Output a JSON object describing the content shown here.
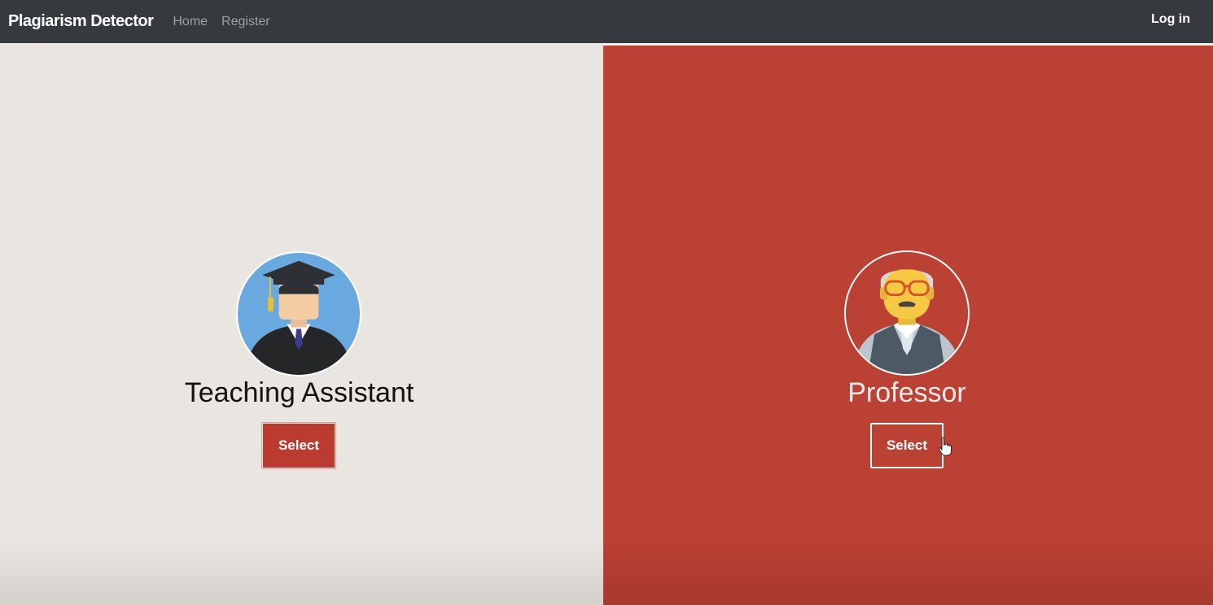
{
  "navbar": {
    "brand": "Plagiarism Detector",
    "links": [
      "Home",
      "Register"
    ],
    "login": "Log in"
  },
  "roles": [
    {
      "title": "Teaching Assistant",
      "button": "Select",
      "avatar_icon": "graduate-avatar-icon"
    },
    {
      "title": "Professor",
      "button": "Select",
      "avatar_icon": "professor-avatar-icon"
    }
  ],
  "colors": {
    "navbar": "#363a3f",
    "left_panel": "#e9e6e2",
    "right_panel": "#bb4134",
    "select_button": "#bb3b30"
  }
}
